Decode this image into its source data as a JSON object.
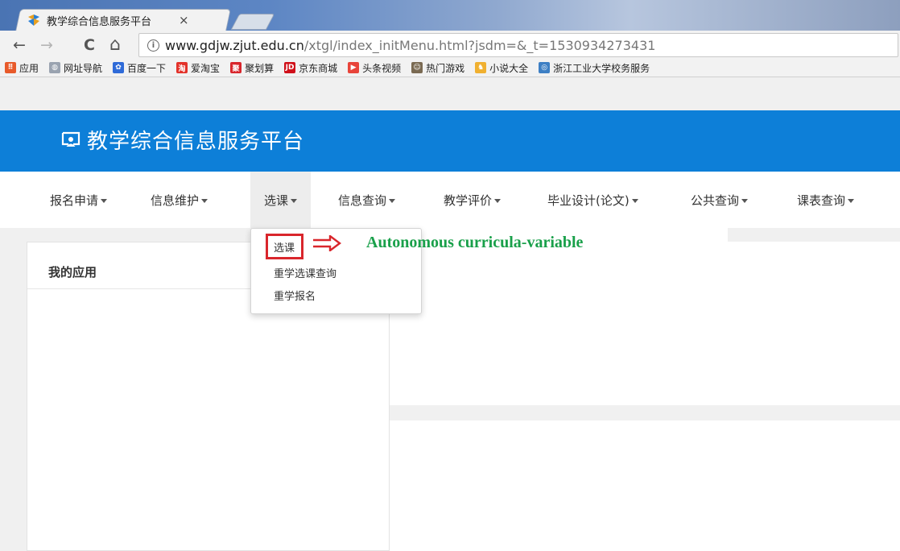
{
  "browser": {
    "tab_title": "教学综合信息服务平台",
    "tab_close": "×",
    "url_host": "www.gdjw.zjut.edu.cn",
    "url_path": "/xtgl/index_initMenu.html?jsdm=&_t=1530934273431",
    "info_glyph": "i",
    "nav": {
      "back": "←",
      "forward": "→",
      "reload": "C",
      "home": "⌂"
    },
    "bookmarks": [
      {
        "label": "应用",
        "icon": "apps-grid-icon",
        "color": "#e85a2a"
      },
      {
        "label": "网址导航",
        "icon": "globe-icon",
        "color": "#9aa3b0"
      },
      {
        "label": "百度一下",
        "icon": "baidu-paw-icon",
        "color": "#2f6bd8"
      },
      {
        "label": "爱淘宝",
        "icon": "taobao-icon",
        "color": "#e3322a"
      },
      {
        "label": "聚划算",
        "icon": "juhuasuan-icon",
        "color": "#d8252b"
      },
      {
        "label": "京东商城",
        "icon": "jd-icon",
        "color": "#d0101a"
      },
      {
        "label": "头条视频",
        "icon": "play-icon",
        "color": "#e8443a"
      },
      {
        "label": "热门游戏",
        "icon": "game-avatar-icon",
        "color": "#7a6a52"
      },
      {
        "label": "小说大全",
        "icon": "book-icon",
        "color": "#f0b030"
      },
      {
        "label": "浙江工业大学校务服务",
        "icon": "zjut-seal-icon",
        "color": "#3d7fc4"
      }
    ]
  },
  "site": {
    "title": "教学综合信息服务平台",
    "header_color": "#0d7fd8"
  },
  "menu": [
    {
      "label": "报名申请"
    },
    {
      "label": "信息维护"
    },
    {
      "label": "选课"
    },
    {
      "label": "信息查询"
    },
    {
      "label": "教学评价"
    },
    {
      "label": "毕业设计(论文)"
    },
    {
      "label": "公共查询"
    },
    {
      "label": "课表查询"
    }
  ],
  "dropdown": {
    "items": [
      {
        "label": "选课"
      },
      {
        "label": "重学选课查询"
      },
      {
        "label": "重学报名"
      }
    ]
  },
  "annotation": {
    "text": "Autonomous curricula-variable",
    "color": "#19a04a",
    "highlight_color": "#d9262c"
  },
  "panels": {
    "my_apps_title": "我的应用"
  }
}
